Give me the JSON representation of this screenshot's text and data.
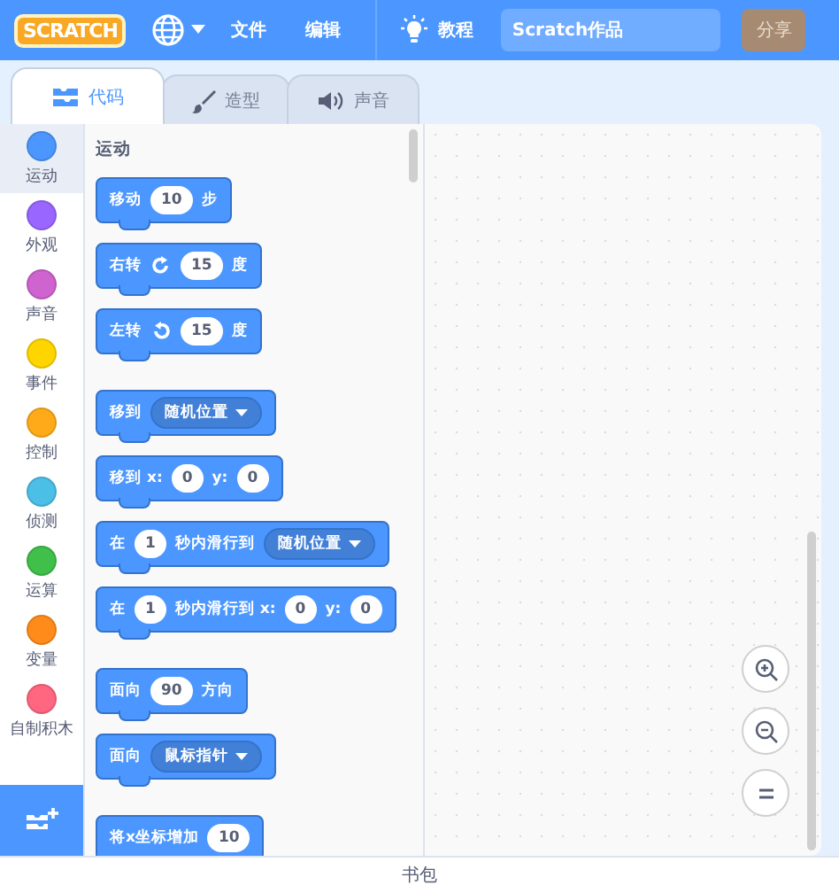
{
  "menu_bar": {
    "logo": "SCRATCH",
    "items": [
      {
        "kind": "language"
      },
      {
        "kind": "text",
        "label": "文件"
      },
      {
        "kind": "text",
        "label": "编辑"
      },
      {
        "kind": "tutorial",
        "label": "教程"
      }
    ],
    "project_title": "Scratch作品",
    "share_button": "分享"
  },
  "tabs": [
    {
      "kind": "code",
      "label": "代码",
      "selected": true
    },
    {
      "kind": "costume",
      "label": "造型",
      "selected": false
    },
    {
      "kind": "sound",
      "label": "声音",
      "selected": false
    }
  ],
  "categories": [
    {
      "label": "运动",
      "color": "#4c97ff",
      "selected": true
    },
    {
      "label": "外观",
      "color": "#9966ff",
      "selected": false
    },
    {
      "label": "声音",
      "color": "#cf63cf",
      "selected": false
    },
    {
      "label": "事件",
      "color": "#ffd500",
      "selected": false
    },
    {
      "label": "控制",
      "color": "#ffab19",
      "selected": false
    },
    {
      "label": "侦测",
      "color": "#4cbfe6",
      "selected": false
    },
    {
      "label": "运算",
      "color": "#40bf4a",
      "selected": false
    },
    {
      "label": "变量",
      "color": "#ff8c1a",
      "selected": false
    },
    {
      "label": "自制积木",
      "color": "#ff6680",
      "selected": false
    }
  ],
  "palette": {
    "heading": "运动",
    "groups": [
      [
        {
          "parts": [
            {
              "kind": "text",
              "text": "移动"
            },
            {
              "kind": "number",
              "text": "10"
            },
            {
              "kind": "text",
              "text": "步"
            }
          ]
        },
        {
          "parts": [
            {
              "kind": "text",
              "text": "右转"
            },
            {
              "kind": "turn-right"
            },
            {
              "kind": "number",
              "text": "15"
            },
            {
              "kind": "text",
              "text": "度"
            }
          ]
        },
        {
          "parts": [
            {
              "kind": "text",
              "text": "左转"
            },
            {
              "kind": "turn-left"
            },
            {
              "kind": "number",
              "text": "15"
            },
            {
              "kind": "text",
              "text": "度"
            }
          ]
        }
      ],
      [
        {
          "parts": [
            {
              "kind": "text",
              "text": "移到"
            },
            {
              "kind": "dropdown",
              "text": "随机位置"
            }
          ]
        },
        {
          "parts": [
            {
              "kind": "text",
              "text": "移到 x:"
            },
            {
              "kind": "number",
              "text": "0"
            },
            {
              "kind": "text",
              "text": "y:"
            },
            {
              "kind": "number",
              "text": "0"
            }
          ]
        },
        {
          "parts": [
            {
              "kind": "text",
              "text": "在"
            },
            {
              "kind": "number",
              "text": "1"
            },
            {
              "kind": "text",
              "text": "秒内滑行到"
            },
            {
              "kind": "dropdown",
              "text": "随机位置"
            }
          ]
        },
        {
          "parts": [
            {
              "kind": "text",
              "text": "在"
            },
            {
              "kind": "number",
              "text": "1"
            },
            {
              "kind": "text",
              "text": "秒内滑行到 x:"
            },
            {
              "kind": "number",
              "text": "0"
            },
            {
              "kind": "text",
              "text": "y:"
            },
            {
              "kind": "number",
              "text": "0"
            }
          ]
        }
      ],
      [
        {
          "parts": [
            {
              "kind": "text",
              "text": "面向"
            },
            {
              "kind": "number",
              "text": "90"
            },
            {
              "kind": "text",
              "text": "方向"
            }
          ]
        },
        {
          "parts": [
            {
              "kind": "text",
              "text": "面向"
            },
            {
              "kind": "dropdown",
              "text": "鼠标指针"
            }
          ]
        }
      ],
      [
        {
          "parts": [
            {
              "kind": "text",
              "text": "将x坐标增加"
            },
            {
              "kind": "number",
              "text": "10"
            }
          ]
        }
      ]
    ]
  },
  "backpack": "书包"
}
